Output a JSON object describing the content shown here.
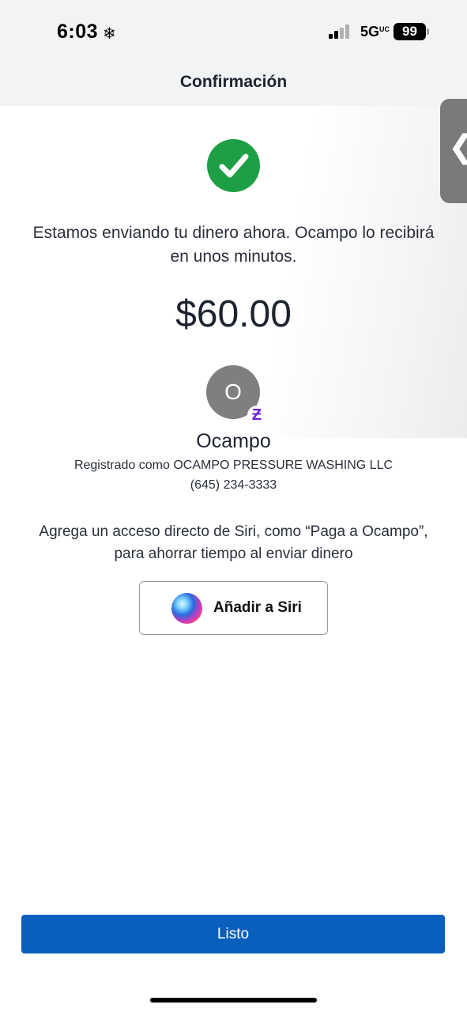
{
  "status_bar": {
    "time": "6:03",
    "weather_glyph": "❄",
    "network": "5G",
    "network_sub": "UC",
    "battery": "99"
  },
  "header": {
    "title": "Confirmación"
  },
  "confirmation": {
    "message": "Estamos enviando tu dinero ahora. Ocampo lo recibirá en unos minutos.",
    "amount": "$60.00"
  },
  "recipient": {
    "initial": "O",
    "badge_glyph": "Ƶ",
    "name": "Ocampo",
    "registered_as": "Registrado como OCAMPO PRESSURE WASHING LLC",
    "phone": "(645) 234-3333"
  },
  "siri": {
    "description": "Agrega un acceso directo de Siri, como “Paga a Ocampo”, para ahorrar tiempo al enviar dinero",
    "button_label": "Añadir a Siri"
  },
  "side_tab": {
    "glyph": "❮"
  },
  "footer": {
    "done_label": "Listo"
  },
  "colors": {
    "success": "#1f9f45",
    "primary": "#0a5fbd",
    "zelle": "#6d1ed4"
  }
}
